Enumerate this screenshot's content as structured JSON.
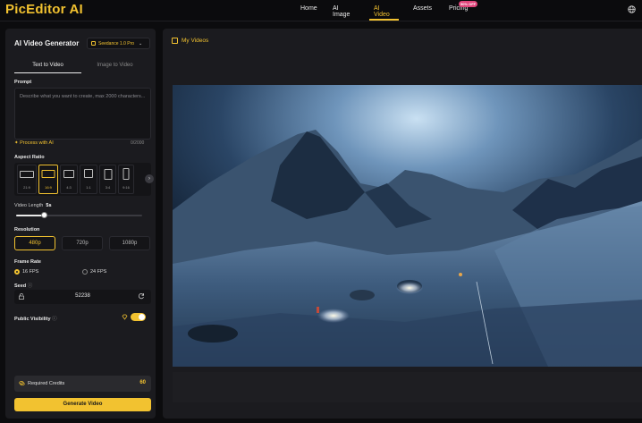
{
  "header": {
    "logo": "PicEditor AI",
    "nav": [
      "Home",
      "AI Image",
      "AI Video",
      "Assets",
      "Pricing"
    ],
    "active_nav": "AI Video",
    "pricing_badge": "50% OFF",
    "globe_icon": "globe-icon"
  },
  "panel": {
    "title": "AI Video Generator",
    "model": "Seedance 1.0 Pro",
    "tabs": [
      "Text to Video",
      "Image to Video"
    ],
    "active_tab": "Text to Video",
    "prompt_label": "Prompt",
    "prompt_placeholder": "Describe what you want to create, max 2000 characters...",
    "process_label": "Process with AI",
    "counter": "0/2000",
    "aspect_label": "Aspect Ratio",
    "ratios": [
      "21:9",
      "16:9",
      "4:3",
      "1:1",
      "3:4",
      "9:16"
    ],
    "selected_ratio": "16:9",
    "video_length_label": "Video Length",
    "video_length_value": "5s",
    "resolution_label": "Resolution",
    "resolutions": [
      "480p",
      "720p",
      "1080p"
    ],
    "selected_resolution": "480p",
    "frame_rate_label": "Frame Rate",
    "frame_rates": [
      "16 FPS",
      "24 FPS"
    ],
    "selected_frame_rate": "16 FPS",
    "seed_label": "Seed",
    "seed_value": "52238",
    "visibility_label": "Public Visibility",
    "visibility_on": true,
    "credits_label": "Required Credits",
    "credits_value": "60",
    "generate_label": "Generate Video"
  },
  "main": {
    "my_videos_label": "My Videos"
  },
  "colors": {
    "accent": "#f2c230",
    "panel": "#1b1b1f",
    "background": "#0c0c0e"
  }
}
